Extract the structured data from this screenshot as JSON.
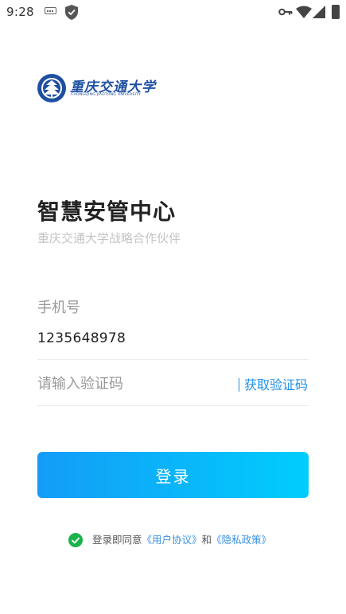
{
  "status_bar": {
    "time": "9:28"
  },
  "logo": {
    "name": "重庆交通大学",
    "subtitle": "CHONGQING JIAOTONG UNIVERSITY"
  },
  "header": {
    "title": "智慧安管中心",
    "subtitle": "重庆交通大学战略合作伙伴"
  },
  "form": {
    "phone_label": "手机号",
    "phone_value": "1235648978",
    "code_placeholder": "请输入验证码",
    "get_code_label": "获取验证码",
    "login_label": "登录"
  },
  "agreement": {
    "prefix": "登录即同意",
    "user_agreement": "《用户协议》",
    "conjunction": "和",
    "privacy_policy": "《隐私政策》"
  },
  "colors": {
    "accent": "#149cf7",
    "accent_end": "#00cdfc",
    "link": "#3a92e0",
    "check": "#19b34a"
  }
}
